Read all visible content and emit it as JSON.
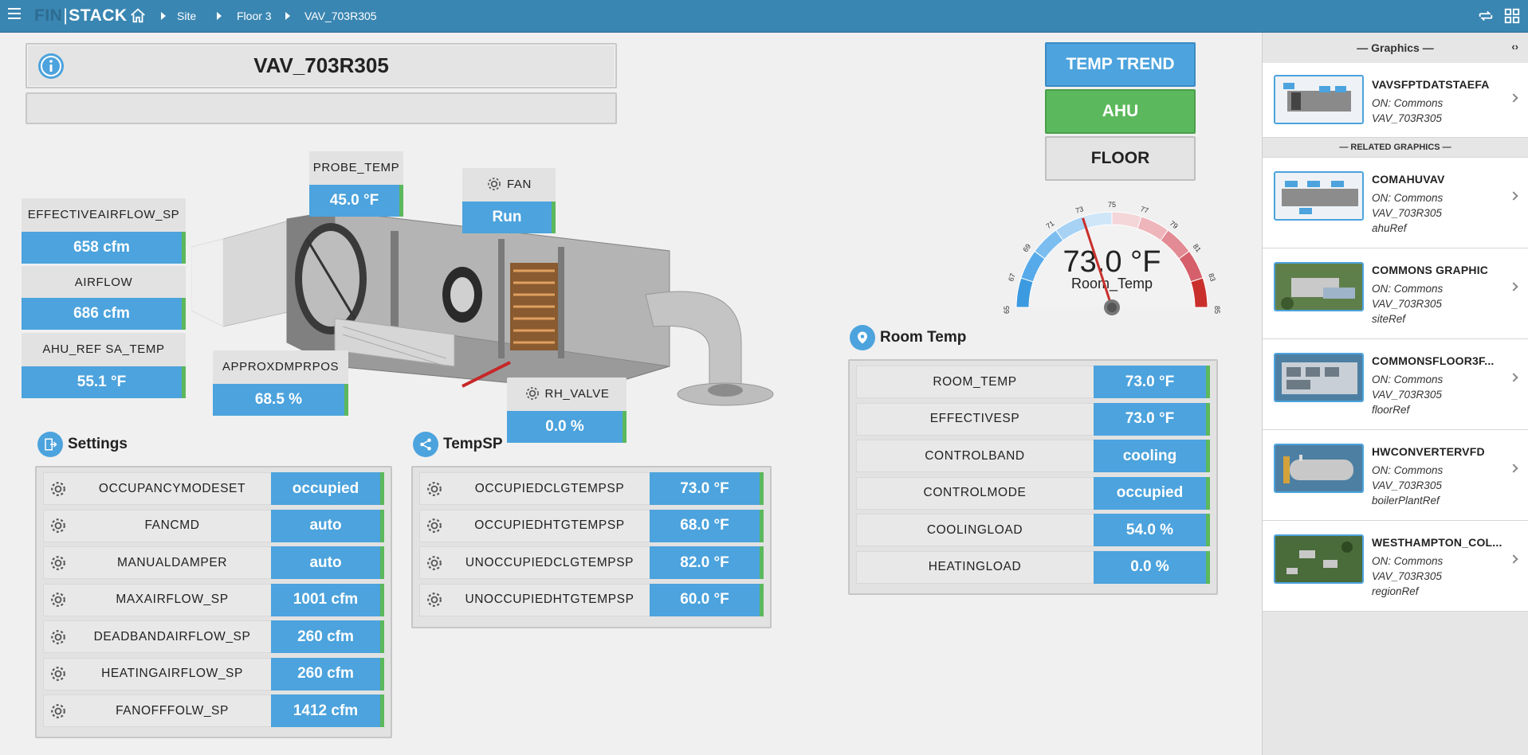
{
  "topbar": {
    "logo_fin": "FIN",
    "logo_stack": "STACK",
    "breadcrumb": [
      "Site",
      "Floor 3",
      "VAV_703R305"
    ]
  },
  "title": "VAV_703R305",
  "buttons": {
    "temp_trend": "TEMP TREND",
    "ahu": "AHU",
    "floor": "FLOOR"
  },
  "equipment": {
    "probe_temp": {
      "label": "PROBE_TEMP",
      "value": "45.0 °F"
    },
    "fan": {
      "label": "FAN",
      "value": "Run"
    },
    "effective_airflow_sp": {
      "label": "EFFECTIVEAIRFLOW_SP",
      "value": "658 cfm"
    },
    "airflow": {
      "label": "AIRFLOW",
      "value": "686 cfm"
    },
    "ahu_ref_sa_temp": {
      "label": "AHU_REF SA_TEMP",
      "value": "55.1 °F"
    },
    "approx_dmpr_pos": {
      "label": "APPROXDMPRPOS",
      "value": "68.5 %"
    },
    "rh_valve": {
      "label": "RH_VALVE",
      "value": "0.0 %"
    }
  },
  "gauge": {
    "value_text": "73.0 °F",
    "label": "Room_Temp",
    "value": 73.0,
    "min": 65,
    "max": 85,
    "ticks": [
      "65",
      "67",
      "69",
      "71",
      "73",
      "75",
      "77",
      "79",
      "81",
      "83",
      "85"
    ]
  },
  "settings": {
    "title": "Settings",
    "rows": [
      {
        "label": "OCCUPANCYMODESET",
        "value": "occupied"
      },
      {
        "label": "FANCMD",
        "value": "auto"
      },
      {
        "label": "MANUALDAMPER",
        "value": "auto"
      },
      {
        "label": "MAXAIRFLOW_SP",
        "value": "1001 cfm"
      },
      {
        "label": "DEADBANDAIRFLOW_SP",
        "value": "260 cfm"
      },
      {
        "label": "HEATINGAIRFLOW_SP",
        "value": "260 cfm"
      },
      {
        "label": "FANOFFFOLW_SP",
        "value": "1412 cfm"
      }
    ]
  },
  "tempsp": {
    "title": "TempSP",
    "rows": [
      {
        "label": "OCCUPIEDCLGTEMPSP",
        "value": "73.0 °F"
      },
      {
        "label": "OCCUPIEDHTGTEMPSP",
        "value": "68.0 °F"
      },
      {
        "label": "UNOCCUPIEDCLGTEMPSP",
        "value": "82.0 °F"
      },
      {
        "label": "UNOCCUPIEDHTGTEMPSP",
        "value": "60.0 °F"
      }
    ]
  },
  "room_temp": {
    "title": "Room Temp",
    "rows": [
      {
        "label": "ROOM_TEMP",
        "value": "73.0 °F"
      },
      {
        "label": "EFFECTIVESP",
        "value": "73.0 °F"
      },
      {
        "label": "CONTROLBAND",
        "value": "cooling"
      },
      {
        "label": "CONTROLMODE",
        "value": "occupied"
      },
      {
        "label": "COOLINGLOAD",
        "value": "54.0 %"
      },
      {
        "label": "HEATINGLOAD",
        "value": "0.0 %"
      }
    ]
  },
  "sidebar": {
    "header": "— Graphics —",
    "related_header": "— RELATED GRAPHICS —",
    "current": {
      "title": "VAVSFPTDATSTAEFA",
      "lines": [
        "ON: Commons",
        "VAV_703R305"
      ]
    },
    "related": [
      {
        "title": "COMAHUVAV",
        "lines": [
          "ON: Commons",
          "VAV_703R305",
          "ahuRef"
        ]
      },
      {
        "title": "COMMONS GRAPHIC",
        "lines": [
          "ON: Commons",
          "VAV_703R305",
          "siteRef"
        ]
      },
      {
        "title": "COMMONSFLOOR3F...",
        "lines": [
          "ON: Commons",
          "VAV_703R305",
          "floorRef"
        ]
      },
      {
        "title": "HWCONVERTERVFD",
        "lines": [
          "ON: Commons",
          "VAV_703R305",
          "boilerPlantRef"
        ]
      },
      {
        "title": "WESTHAMPTON_COL...",
        "lines": [
          "ON: Commons",
          "VAV_703R305",
          "regionRef"
        ]
      }
    ]
  },
  "colors": {
    "topbar": "#3a86b2",
    "value_blue": "#4ca3dd",
    "status_green": "#5cb85c",
    "gauge_red": "#c9302c"
  }
}
